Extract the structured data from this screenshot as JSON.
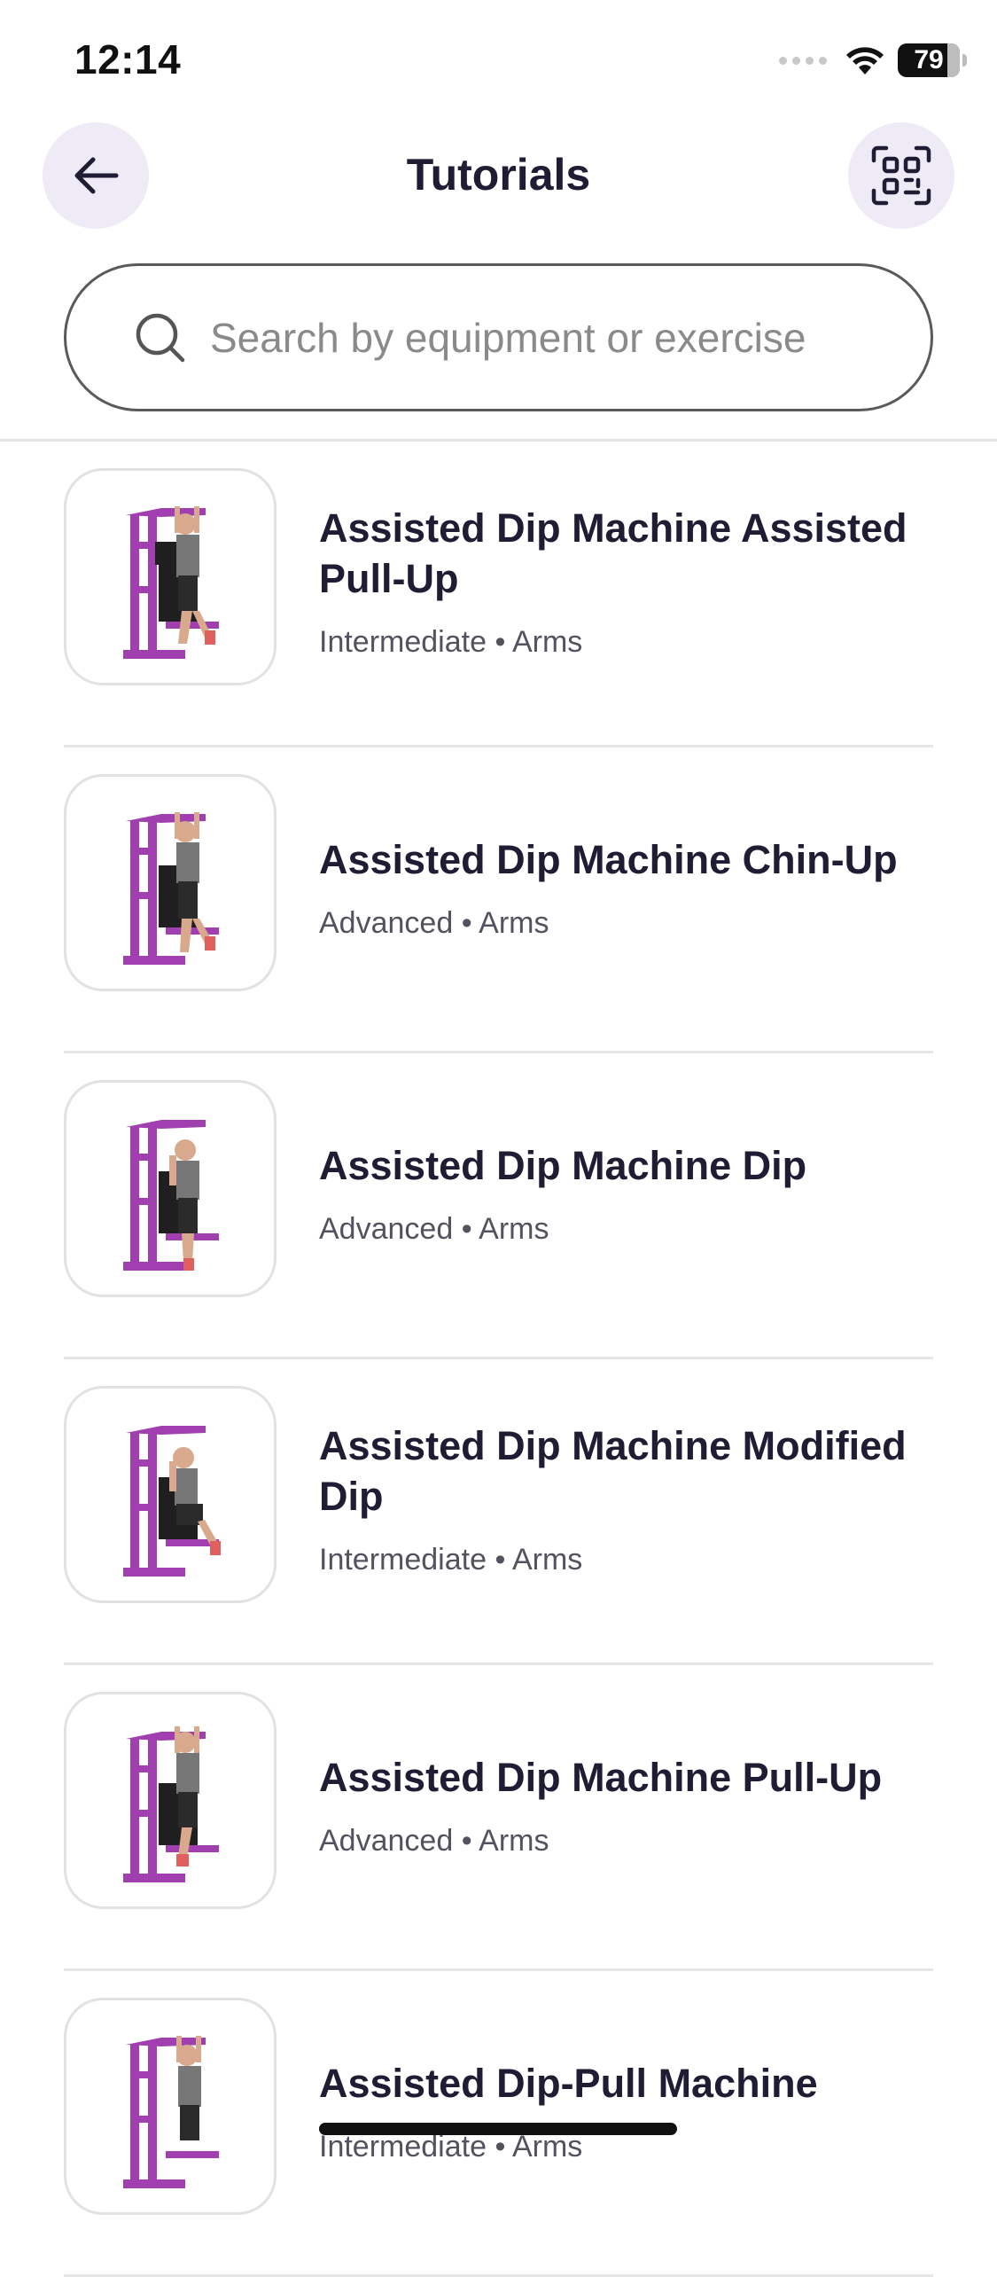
{
  "status_bar": {
    "time": "12:14",
    "battery": "79"
  },
  "header": {
    "title": "Tutorials"
  },
  "search": {
    "placeholder": "Search by equipment or exercise"
  },
  "colors": {
    "accent_bg": "#eeebf7",
    "machine": "#a23fb0",
    "text": "#1f1c33"
  },
  "tutorials": [
    {
      "title": "Assisted Dip Machine Assisted Pull-Up",
      "level": "Intermediate",
      "category": "Arms",
      "separator": "•"
    },
    {
      "title": "Assisted Dip Machine Chin-Up",
      "level": "Advanced",
      "category": "Arms",
      "separator": "•"
    },
    {
      "title": "Assisted Dip Machine Dip",
      "level": "Advanced",
      "category": "Arms",
      "separator": "•"
    },
    {
      "title": "Assisted Dip Machine Modified Dip",
      "level": "Intermediate",
      "category": "Arms",
      "separator": "•"
    },
    {
      "title": "Assisted Dip Machine Pull-Up",
      "level": "Advanced",
      "category": "Arms",
      "separator": "•"
    },
    {
      "title": "Assisted Dip-Pull Machine",
      "level": "Intermediate",
      "category": "Arms",
      "separator": "•"
    }
  ]
}
